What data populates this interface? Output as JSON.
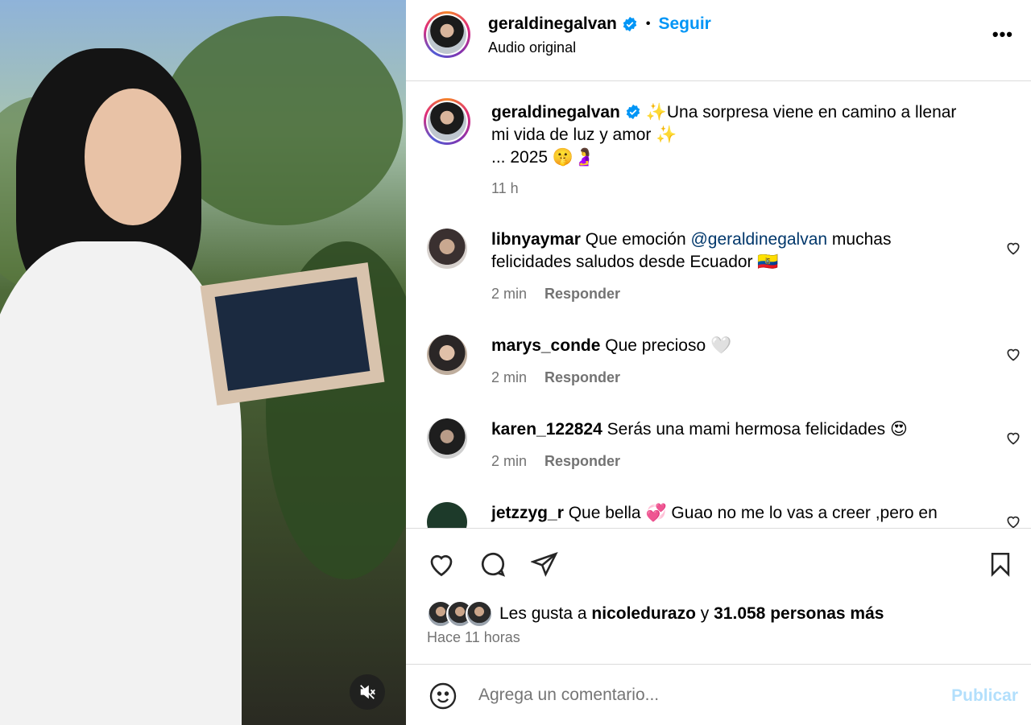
{
  "post": {
    "username": "geraldinegalvan",
    "follow_label": "Seguir",
    "audio": "Audio original",
    "more_label": "•••",
    "caption_line1": "✨Una sorpresa viene en camino a llenar",
    "caption_line2": "mi vida de luz y amor ✨",
    "caption_line3": "... 2025 🤫🤰",
    "caption_time": "11 h"
  },
  "comments": [
    {
      "user": "libnyaymar",
      "text_a": "Que emoción ",
      "mention": "@geraldinegalvan",
      "text_b": " muchas",
      "line2": "felicidades saludos desde Ecuador 🇪🇨",
      "time": "2 min",
      "reply": "Responder"
    },
    {
      "user": "marys_conde",
      "text": "Que precioso 🤍",
      "time": "2 min",
      "reply": "Responder"
    },
    {
      "user": "karen_122824",
      "text": "Serás una mami hermosa felicidades 😍",
      "time": "2 min",
      "reply": "Responder"
    },
    {
      "user": "jetzzyg_r",
      "text": "Que bella 💞 Guao no me lo vas a creer ,pero en"
    }
  ],
  "footer": {
    "likes_prefix": "Les gusta a ",
    "likes_user": "nicoledurazo",
    "likes_mid": " y ",
    "likes_count": "31.058 personas más",
    "time_ago": "Hace 11 horas",
    "comment_placeholder": "Agrega un comentario...",
    "publish_label": "Publicar"
  },
  "colors": {
    "accent": "#0095f6",
    "verified": "#0095f6",
    "muted": "#737373",
    "border": "#dbdbdb"
  },
  "icons": [
    "heart-icon",
    "comment-icon",
    "share-icon",
    "bookmark-icon",
    "emoji-icon",
    "mute-icon",
    "verified-icon",
    "more-icon"
  ]
}
